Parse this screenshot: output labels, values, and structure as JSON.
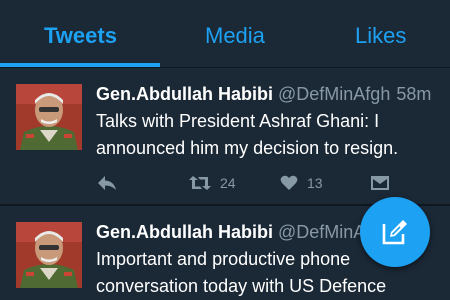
{
  "tabs": [
    {
      "label": "Tweets",
      "active": true
    },
    {
      "label": "Media",
      "active": false
    },
    {
      "label": "Likes",
      "active": false
    }
  ],
  "tweets": [
    {
      "name": "Gen.Abdullah Habibi",
      "handle": "@DefMinAfgh",
      "time": "58m",
      "text": "Talks with President Ashraf Ghani: I announced him my decision to resign.",
      "retweets": "24",
      "likes": "13"
    },
    {
      "name": "Gen.Abdullah Habibi",
      "handle": "@DefMinAfgh",
      "time": "",
      "text": "Important and productive phone conversation today with US Defence"
    }
  ],
  "colors": {
    "accent": "#1da1f2",
    "background": "#1b2836",
    "muted": "#8899a6"
  },
  "icons": {
    "compose": "compose-icon",
    "reply": "reply-icon",
    "retweet": "retweet-icon",
    "like": "heart-icon",
    "dm": "envelope-icon"
  }
}
